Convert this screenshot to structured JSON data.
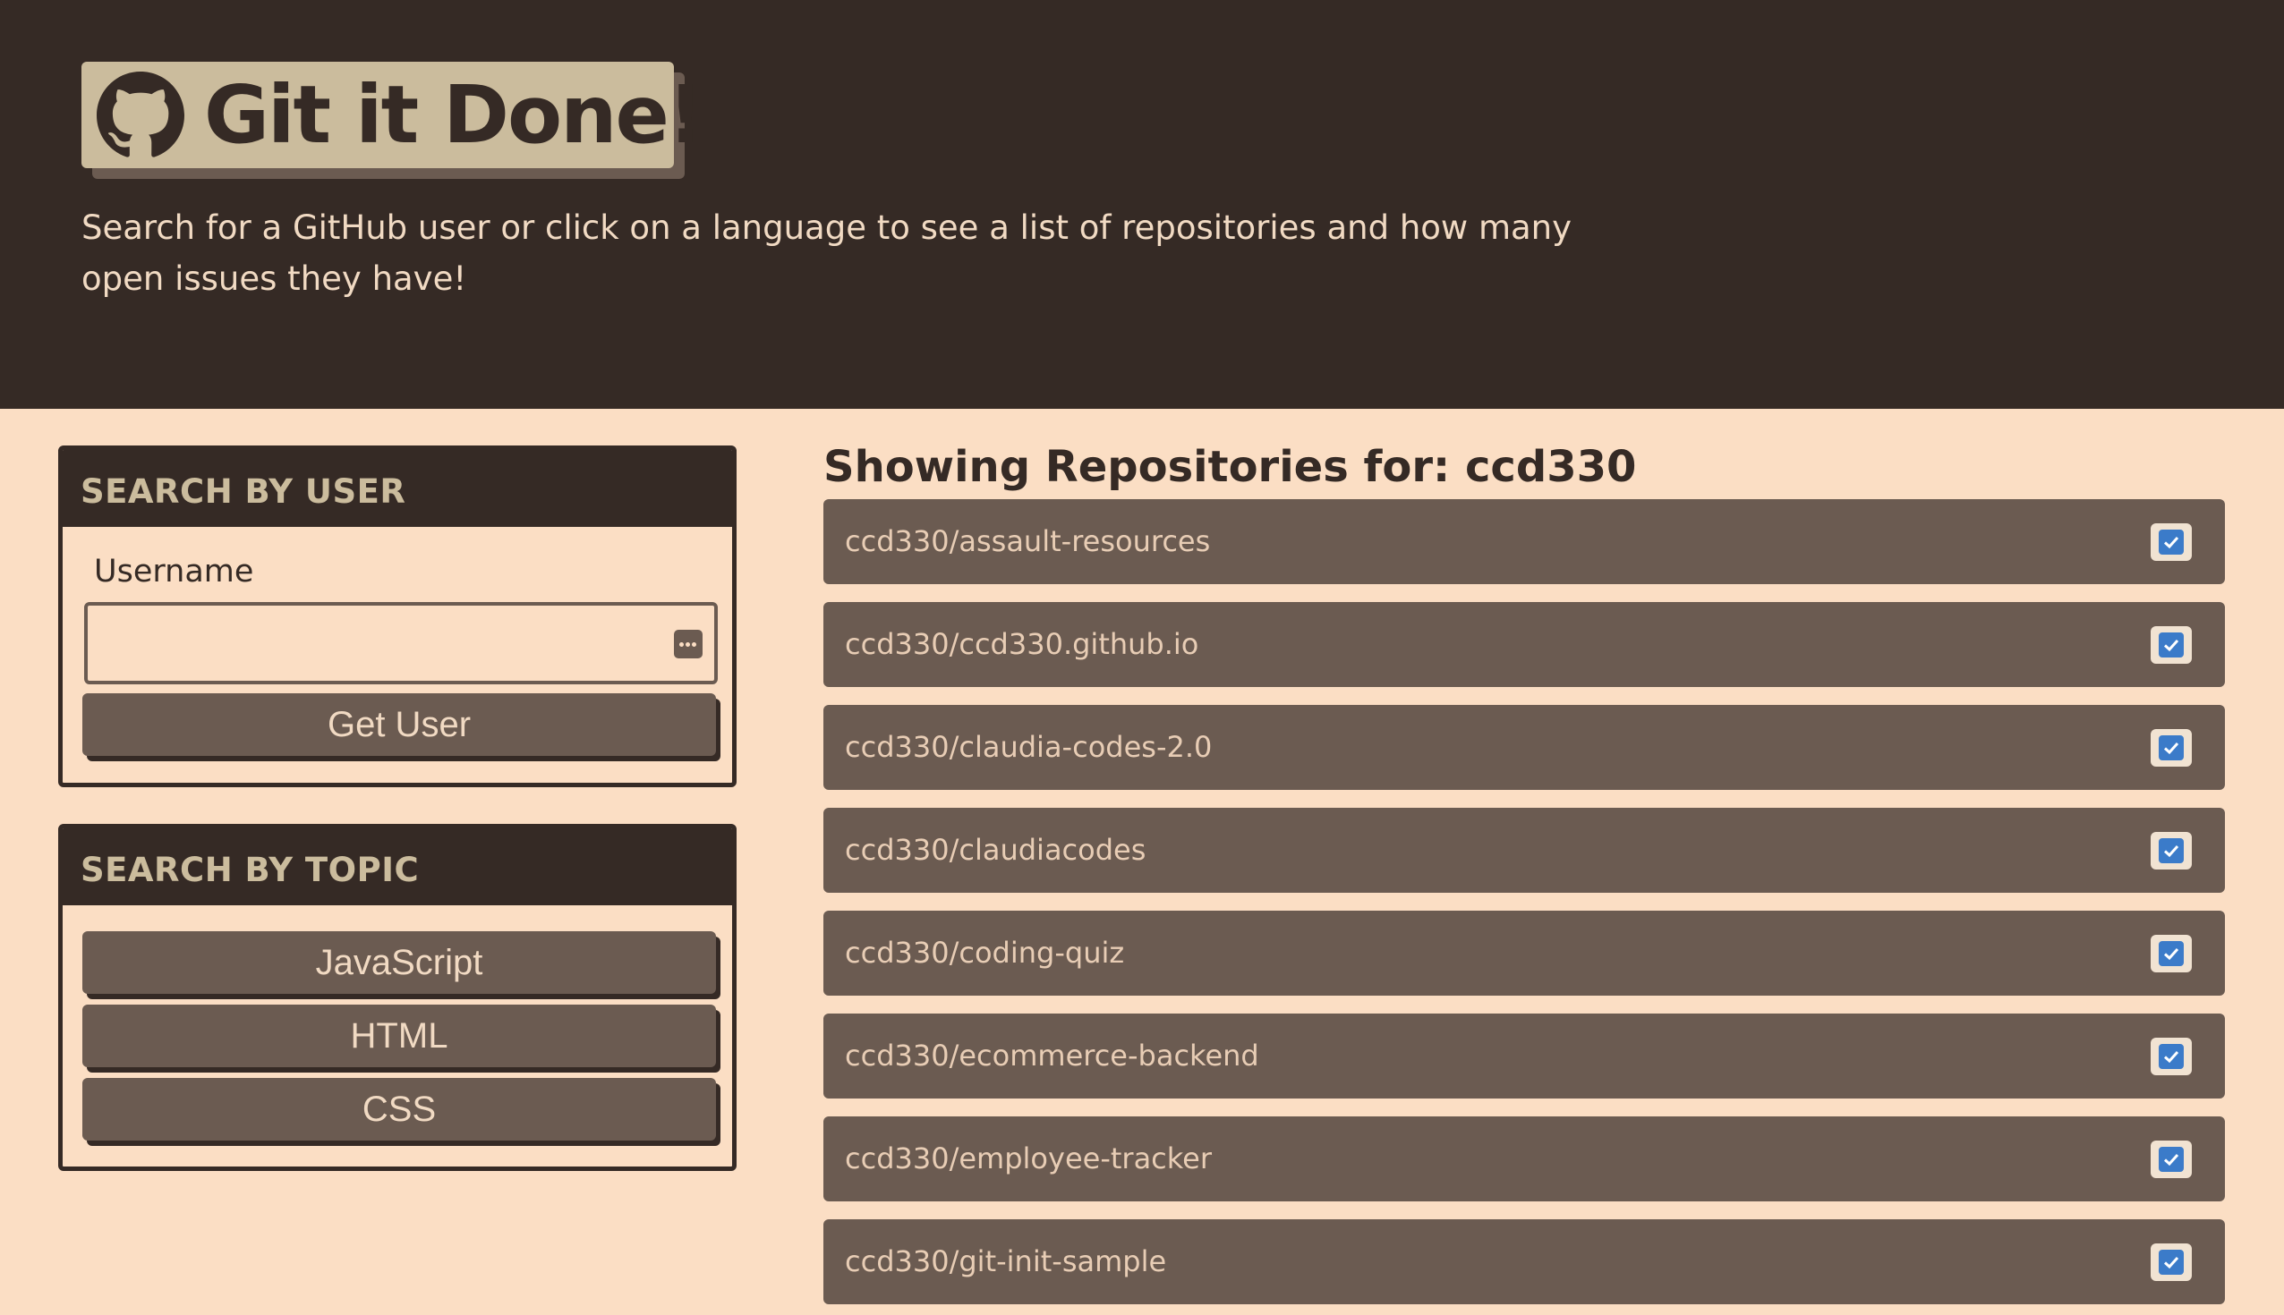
{
  "header": {
    "title": "Git it Done!",
    "logo_icon": "github-icon",
    "subtitle": "Search for a GitHub user or click on a language to see a list of repositories and how many open issues they have!"
  },
  "user_search": {
    "heading": "SEARCH BY USER",
    "label": "Username",
    "input_value": "",
    "input_placeholder": "",
    "autofill_icon": "keychain-icon",
    "button_label": "Get User"
  },
  "topic_search": {
    "heading": "SEARCH BY TOPIC",
    "buttons": [
      "JavaScript",
      "HTML",
      "CSS"
    ]
  },
  "repos": {
    "heading": "Showing Repositories for: ccd330",
    "status_icon": "checkbox-checked-icon",
    "items": [
      "ccd330/assault-resources",
      "ccd330/ccd330.github.io",
      "ccd330/claudia-codes-2.0",
      "ccd330/claudiacodes",
      "ccd330/coding-quiz",
      "ccd330/ecommerce-backend",
      "ccd330/employee-tracker",
      "ccd330/git-init-sample"
    ]
  },
  "colors": {
    "header_bg": "#352a25",
    "page_bg": "#fbdec4",
    "badge_bg": "#cbbc9d",
    "item_bg": "#6b5b51",
    "check_blue": "#3b7bc9"
  }
}
